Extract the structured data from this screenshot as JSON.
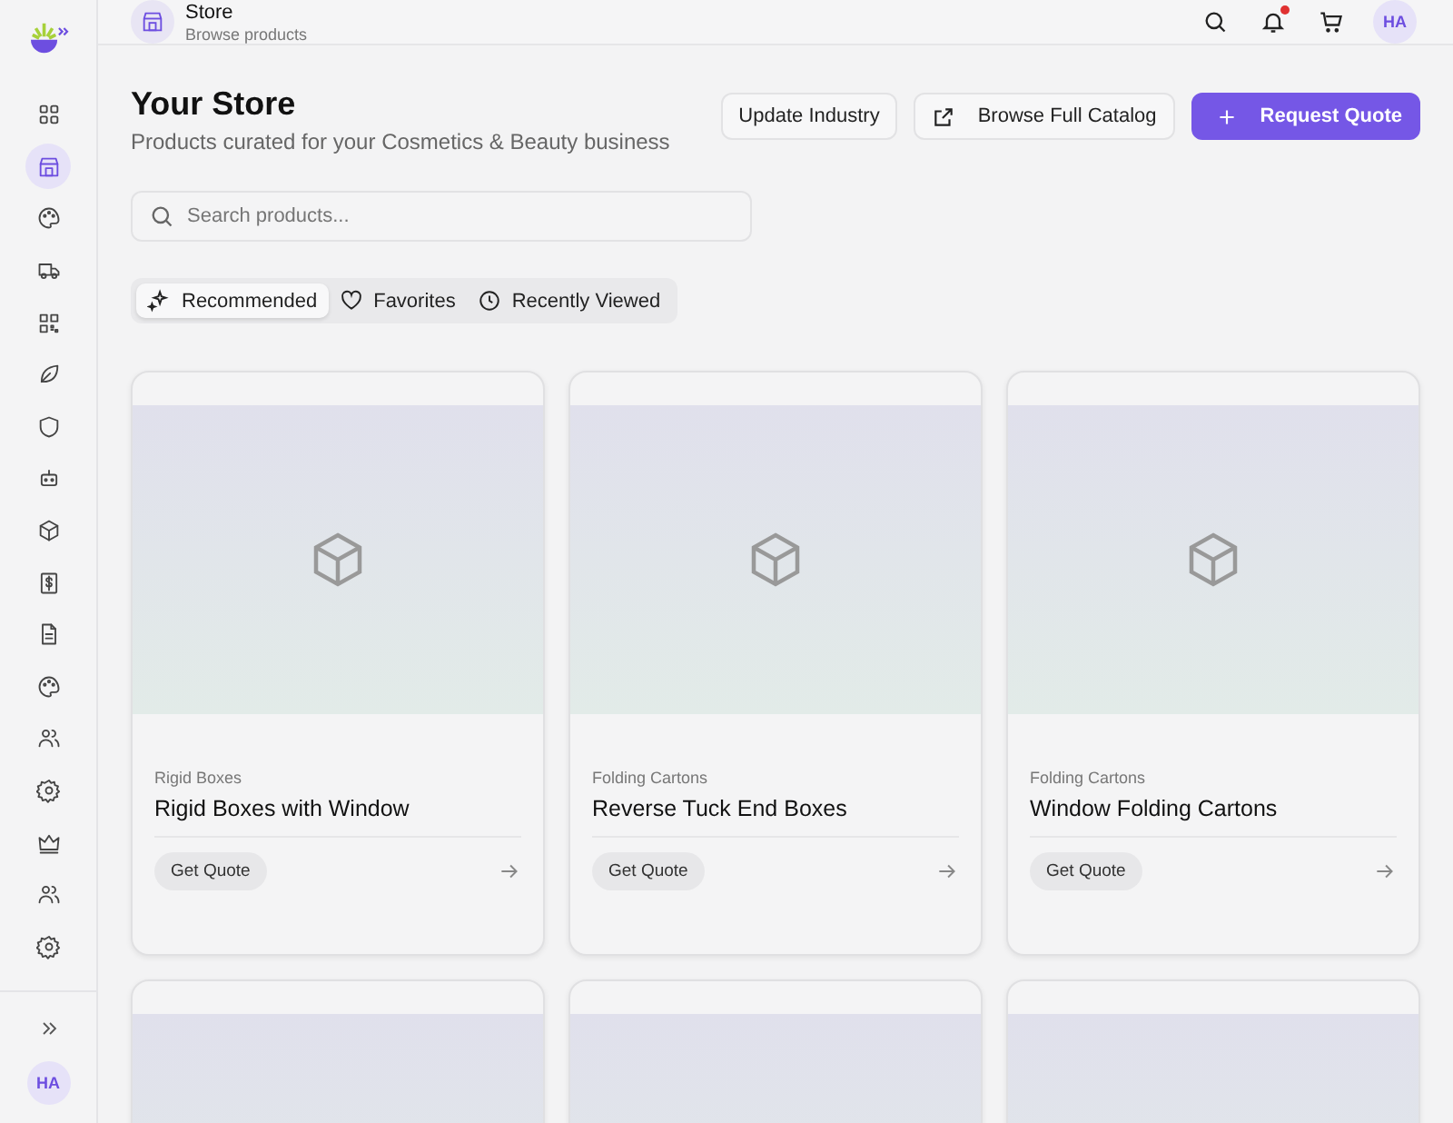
{
  "sidebar": {
    "items": [
      {
        "kind": "grid",
        "selected": false
      },
      {
        "kind": "store",
        "selected": true
      },
      {
        "kind": "palette",
        "selected": false
      },
      {
        "kind": "truck",
        "selected": false
      },
      {
        "kind": "qr",
        "selected": false
      },
      {
        "kind": "leaf",
        "selected": false
      },
      {
        "kind": "shield",
        "selected": false
      },
      {
        "kind": "bot",
        "selected": false
      },
      {
        "kind": "box",
        "selected": false
      },
      {
        "kind": "dollar",
        "selected": false
      },
      {
        "kind": "file",
        "selected": false
      },
      {
        "kind": "palette",
        "selected": false
      },
      {
        "kind": "users",
        "selected": false
      },
      {
        "kind": "gear",
        "selected": false
      },
      {
        "kind": "crown",
        "selected": false
      },
      {
        "kind": "users",
        "selected": false
      },
      {
        "kind": "gear",
        "selected": false
      }
    ],
    "avatar": "HA"
  },
  "header": {
    "title": "Store",
    "subtitle": "Browse products",
    "notifications": true,
    "avatar": "HA"
  },
  "page": {
    "title": "Your Store",
    "subtitle": "Products curated for your Cosmetics & Beauty business"
  },
  "buttons": [
    {
      "kind": "plain",
      "label": "Update Industry"
    },
    {
      "kind": "external",
      "label": "Browse Full Catalog"
    },
    {
      "kind": "primary",
      "label": "Request Quote"
    }
  ],
  "search": {
    "placeholder": "Search products..."
  },
  "tabs": [
    {
      "kind": "sparkles",
      "label": "Recommended",
      "selected": true
    },
    {
      "kind": "heart",
      "label": "Favorites",
      "selected": false
    },
    {
      "kind": "clock",
      "label": "Recently Viewed",
      "selected": false
    }
  ],
  "cards": [
    {
      "kind": "product",
      "category": "Rigid Boxes",
      "title": "Rigid Boxes with Window",
      "action": "Get Quote"
    },
    {
      "kind": "product",
      "category": "Folding Cartons",
      "title": "Reverse Tuck End Boxes",
      "action": "Get Quote"
    },
    {
      "kind": "product",
      "category": "Folding Cartons",
      "title": "Window Folding Cartons",
      "action": "Get Quote"
    },
    {
      "kind": "partial"
    },
    {
      "kind": "partial"
    },
    {
      "kind": "partial"
    }
  ]
}
